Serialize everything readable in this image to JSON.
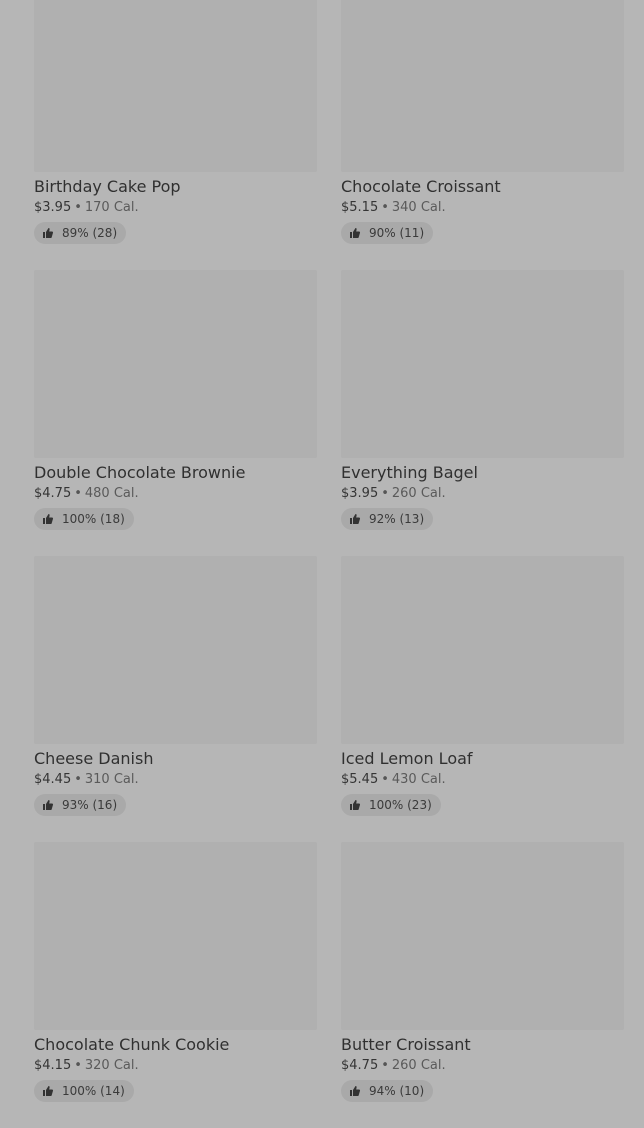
{
  "menu": {
    "items": [
      {
        "name": "Birthday Cake Pop",
        "price": "$3.95",
        "calories": "170 Cal.",
        "rating": "89% (28)"
      },
      {
        "name": "Chocolate Croissant",
        "price": "$5.15",
        "calories": "340 Cal.",
        "rating": "90% (11)"
      },
      {
        "name": "Double Chocolate Brownie",
        "price": "$4.75",
        "calories": "480 Cal.",
        "rating": "100% (18)"
      },
      {
        "name": "Everything Bagel",
        "price": "$3.95",
        "calories": "260 Cal.",
        "rating": "92% (13)"
      },
      {
        "name": "Cheese Danish",
        "price": "$4.45",
        "calories": "310 Cal.",
        "rating": "93% (16)"
      },
      {
        "name": "Iced Lemon Loaf",
        "price": "$5.45",
        "calories": "430 Cal.",
        "rating": "100% (23)"
      },
      {
        "name": "Chocolate Chunk Cookie",
        "price": "$4.15",
        "calories": "320 Cal.",
        "rating": "100% (14)"
      },
      {
        "name": "Butter Croissant",
        "price": "$4.75",
        "calories": "260 Cal.",
        "rating": "94% (10)"
      }
    ],
    "separator": "•",
    "rating_icon": "thumbs-up-icon"
  }
}
